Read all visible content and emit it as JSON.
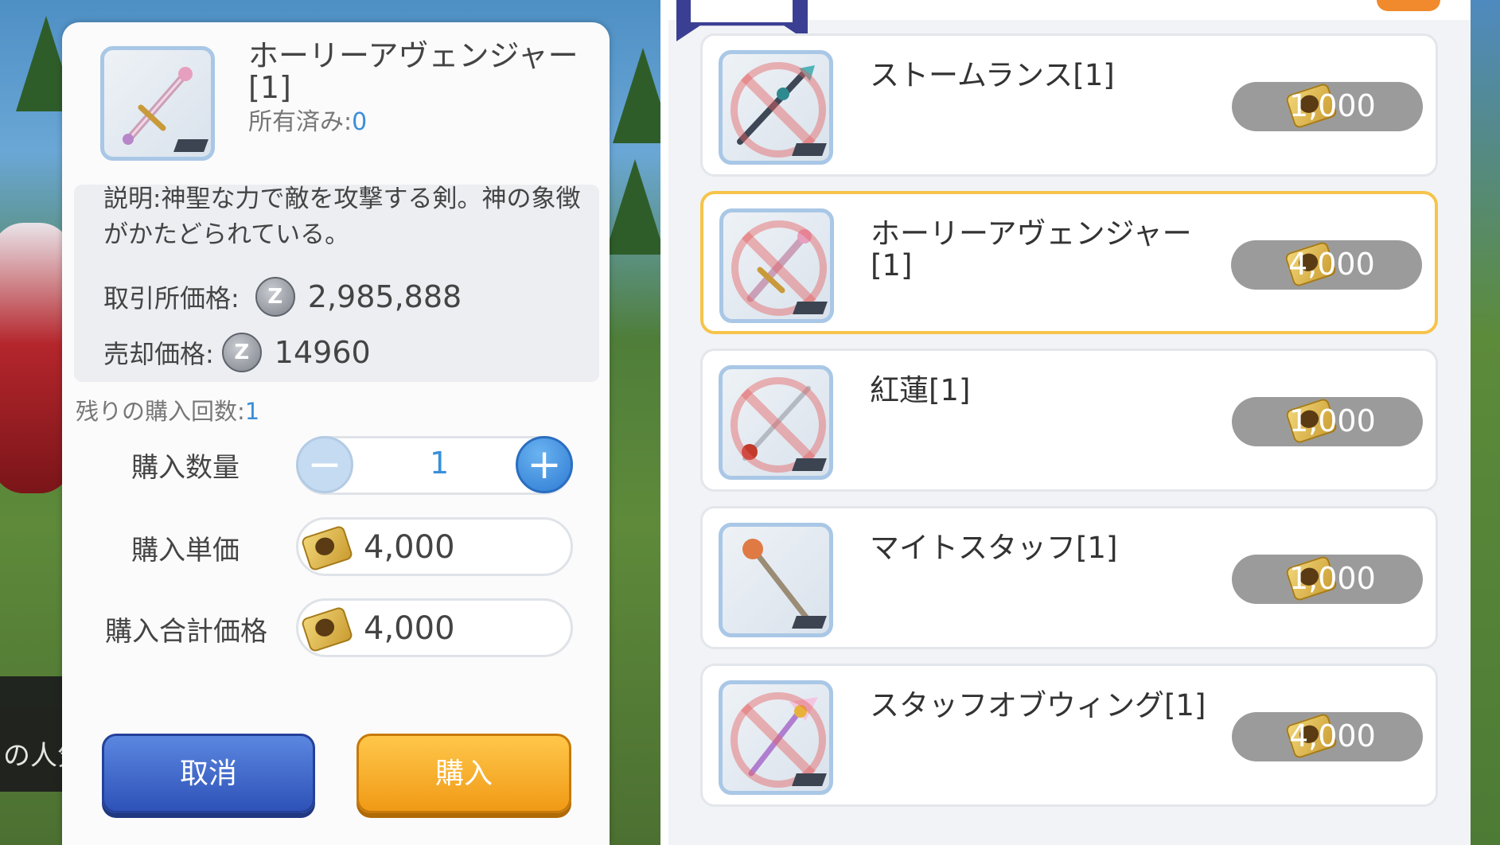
{
  "detail": {
    "title": "ホーリーアヴェンジャー[1]",
    "owned_label": "所有済み:",
    "owned_value": "0",
    "description": "説明:神聖な力で敵を攻撃する剣。神の象徴がかたどられている。",
    "exchange_label": "取引所価格:",
    "exchange_value": "2,985,888",
    "sell_label": "売却価格:",
    "sell_value": "14960",
    "zeny_symbol": "Z",
    "remaining_label": "残りの購入回数:",
    "remaining_value": "1",
    "qty_label": "購入数量",
    "qty_value": "1",
    "minus_symbol": "−",
    "plus_symbol": "+",
    "unit_label": "購入単価",
    "unit_value": "4,000",
    "total_label": "購入合計価格",
    "total_value": "4,000",
    "cancel_label": "取消",
    "buy_label": "購入"
  },
  "background": {
    "chat_text": "の人気"
  },
  "shop_items": [
    {
      "name": "ストームランス[1]",
      "price": "1,000",
      "prohibited": true,
      "selected": false
    },
    {
      "name": "ホーリーアヴェンジャー[1]",
      "price": "4,000",
      "prohibited": true,
      "selected": true
    },
    {
      "name": "紅蓮[1]",
      "price": "1,000",
      "prohibited": true,
      "selected": false
    },
    {
      "name": "マイトスタッフ[1]",
      "price": "1,000",
      "prohibited": false,
      "selected": false
    },
    {
      "name": "スタッフオブウィング[1]",
      "price": "4,000",
      "prohibited": true,
      "selected": false
    }
  ],
  "colors": {
    "accent_blue": "#3a8fd8",
    "selected_border": "#f6c44b",
    "cancel_button": "#2e52b8",
    "buy_button": "#f09a16",
    "price_pill": "#9b9b9b"
  }
}
